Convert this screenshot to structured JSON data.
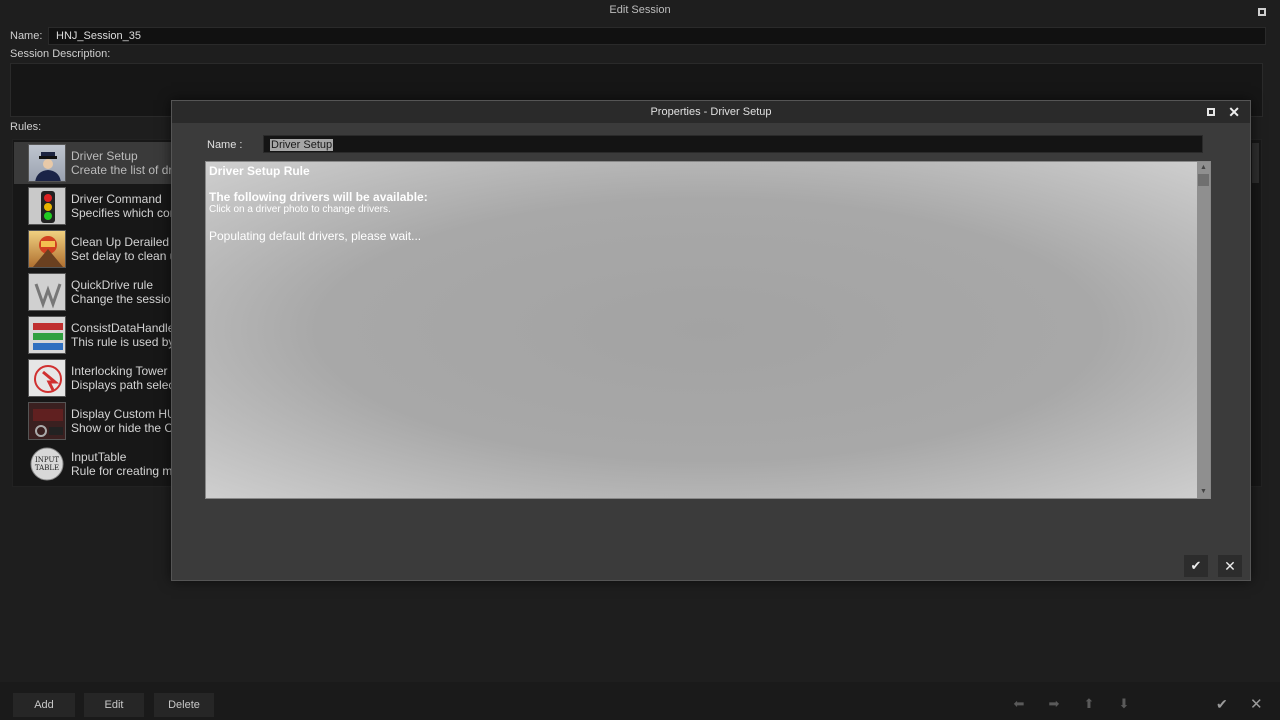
{
  "window": {
    "title": "Edit Session"
  },
  "session": {
    "name_label": "Name:",
    "name_value": "HNJ_Session_35",
    "description_label": "Session Description:",
    "rules_label": "Rules:"
  },
  "rules": [
    {
      "title": "Driver Setup",
      "desc": "Create the list of dr",
      "icon": "driver-icon"
    },
    {
      "title": "Driver Command",
      "desc": "Specifies which com",
      "icon": "traffic-light-icon"
    },
    {
      "title": "Clean Up Derailed T",
      "desc": "Set delay to clean u",
      "icon": "derail-icon"
    },
    {
      "title": "QuickDrive rule",
      "desc": "Change the session",
      "icon": "quickdrive-icon"
    },
    {
      "title": "ConsistDataHandle",
      "desc": "This rule is used by",
      "icon": "consist-icon"
    },
    {
      "title": "Interlocking Tower I",
      "desc": "Displays path selec",
      "icon": "interlocking-icon"
    },
    {
      "title": "Display Custom HU",
      "desc": "Show or hide the C",
      "icon": "hud-icon"
    },
    {
      "title": "InputTable",
      "desc": "Rule for creating m",
      "icon": "input-table-icon"
    }
  ],
  "input_table_icon_text": [
    "INPUT",
    "TABLE"
  ],
  "bottom": {
    "add": "Add",
    "edit": "Edit",
    "delete": "Delete",
    "ok_icon": "check-icon",
    "cancel_icon": "close-icon"
  },
  "modal": {
    "title": "Properties - Driver Setup",
    "name_label": "Name :",
    "name_value": "Driver Setup",
    "heading": "Driver Setup Rule",
    "subheading": "The following drivers will be available:",
    "instruction": "Click on a driver photo to change drivers.",
    "status": "Populating default drivers, please wait..."
  },
  "colors": {
    "background": "#1e1e1e",
    "modal": "#3b3b3b",
    "panel": "#a8a8a8",
    "selected_row": "#3a3a3a"
  }
}
